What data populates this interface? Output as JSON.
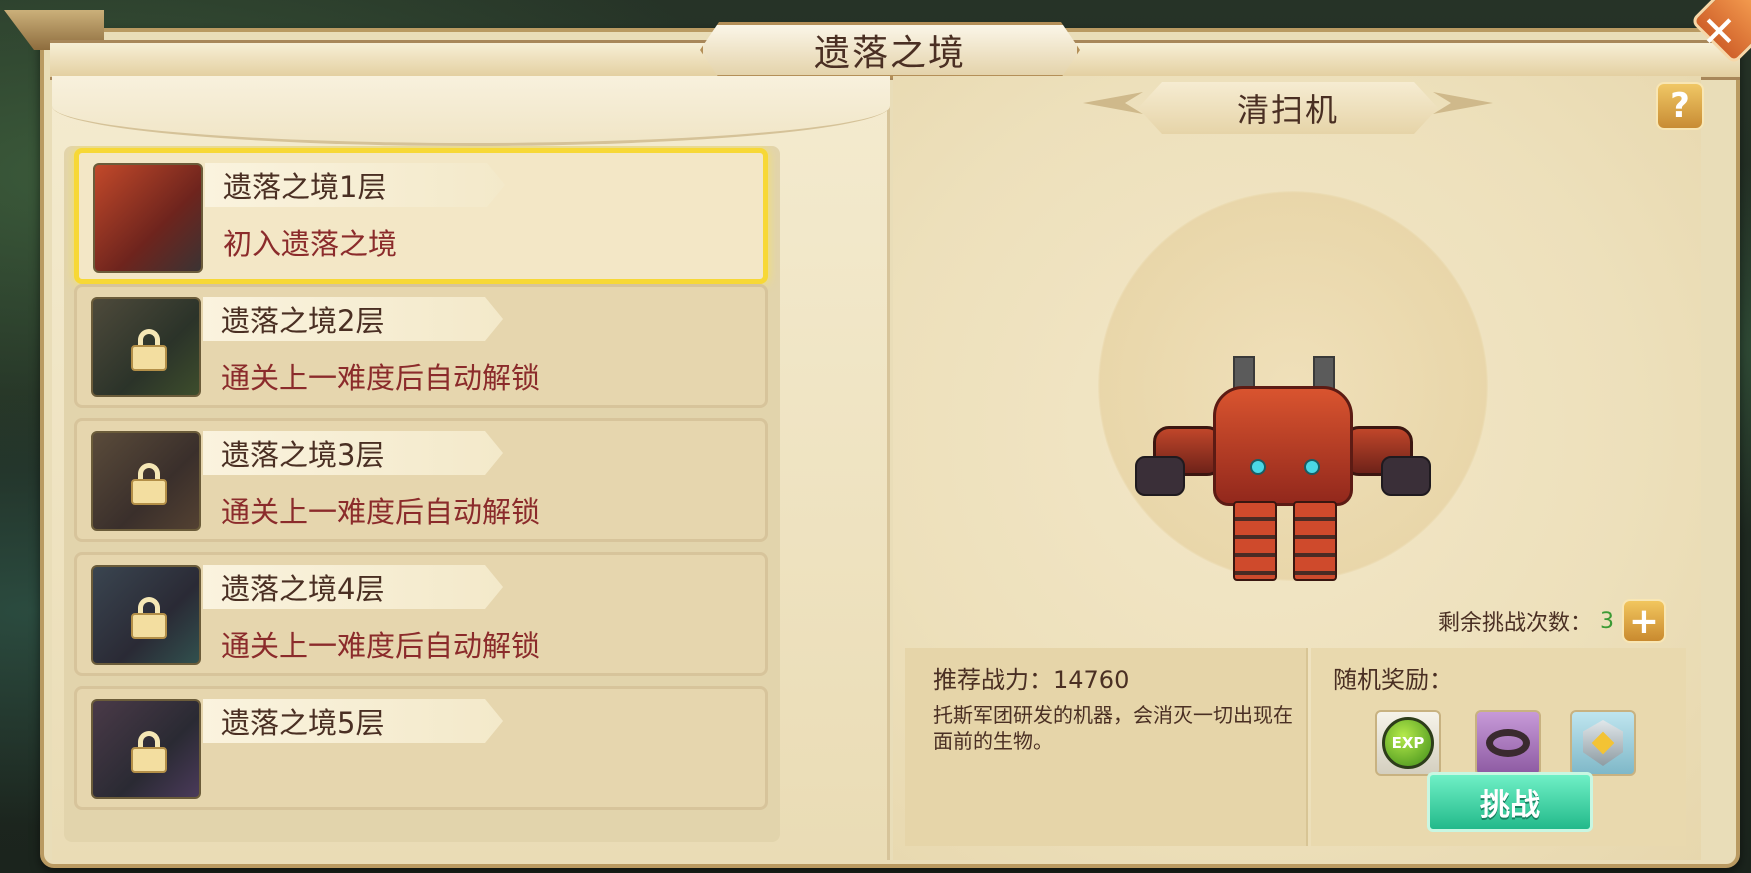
{
  "window": {
    "title": "遗落之境",
    "close_icon": "close-icon"
  },
  "levels": [
    {
      "name": "遗落之境1层",
      "desc": "初入遗落之境",
      "locked": false,
      "selected": true
    },
    {
      "name": "遗落之境2层",
      "desc": "通关上一难度后自动解锁",
      "locked": true,
      "selected": false
    },
    {
      "name": "遗落之境3层",
      "desc": "通关上一难度后自动解锁",
      "locked": true,
      "selected": false
    },
    {
      "name": "遗落之境4层",
      "desc": "通关上一难度后自动解锁",
      "locked": true,
      "selected": false
    },
    {
      "name": "遗落之境5层",
      "desc": "",
      "locked": true,
      "selected": false
    }
  ],
  "monster": {
    "name": "清扫机",
    "help_label": "?",
    "remaining_label": "剩余挑战次数：",
    "remaining_count": "3",
    "add_label": "+"
  },
  "info": {
    "power_label": "推荐战力：14760",
    "desc": "托斯军团研发的机器，会消灭一切出现在面前的生物。"
  },
  "rewards": {
    "title": "随机奖励：",
    "items": [
      {
        "icon": "exp-icon",
        "label": "EXP"
      },
      {
        "icon": "ring-icon"
      },
      {
        "icon": "medal-icon"
      }
    ]
  },
  "actions": {
    "challenge_label": "挑战"
  },
  "colors": {
    "selected_border": "#f7d836",
    "desc_red": "#8b2b2b",
    "count_green": "#3b9a34",
    "challenge_green": "#23b98a"
  }
}
